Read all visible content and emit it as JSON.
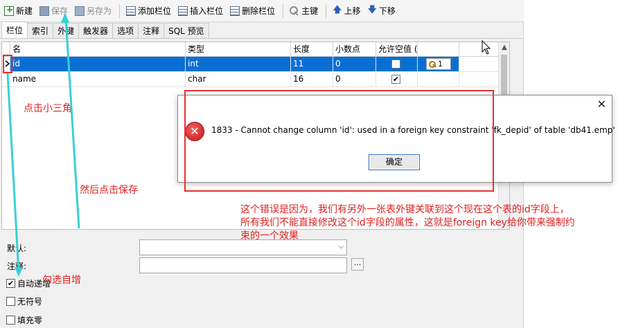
{
  "toolbar": {
    "new_label": "新建",
    "save_label": "保存",
    "saveas_label": "另存为",
    "add_field_label": "添加栏位",
    "insert_field_label": "插入栏位",
    "delete_field_label": "删除栏位",
    "primary_key_label": "主键",
    "move_up_label": "上移",
    "move_down_label": "下移"
  },
  "tabs": [
    "栏位",
    "索引",
    "外键",
    "触发器",
    "选项",
    "注释",
    "SQL 预览"
  ],
  "grid": {
    "headers": [
      "名",
      "类型",
      "长度",
      "小数点",
      "允许空值 (",
      ""
    ],
    "rows": [
      {
        "name": "id",
        "type": "int",
        "length": "11",
        "decimals": "0",
        "key": "1"
      },
      {
        "name": "name",
        "type": "char",
        "length": "16",
        "decimals": "0",
        "key": ""
      }
    ]
  },
  "props": {
    "default_label": "默认:",
    "comment_label": "注释:",
    "dots_label": "...",
    "auto_increment_label": "自动递增",
    "unsigned_label": "无符号",
    "zerofill_label": "填充零"
  },
  "dialog": {
    "message": "1833 - Cannot change column 'id': used in a foreign key constraint 'fk_depid' of table 'db41.emp'",
    "ok_label": "确定",
    "close_glyph": "✕"
  },
  "annotations": {
    "click_triangle": "点击小三角",
    "then_save": "然后点击保存",
    "check_autoinc": "勾选自增",
    "note_line1": "这个错误是因为，我们有另外一张表外键关联到这个现在这个表的id字段上，",
    "note_line2": "所有我们不能直接修改这个id字段的属性，这就是foreign key给你带来强制约",
    "note_line3": "束的一个效果"
  },
  "colors": {
    "selection": "#0a6fd3",
    "annotation_red": "#e02020",
    "annotation_cyan": "#37d0d8"
  }
}
